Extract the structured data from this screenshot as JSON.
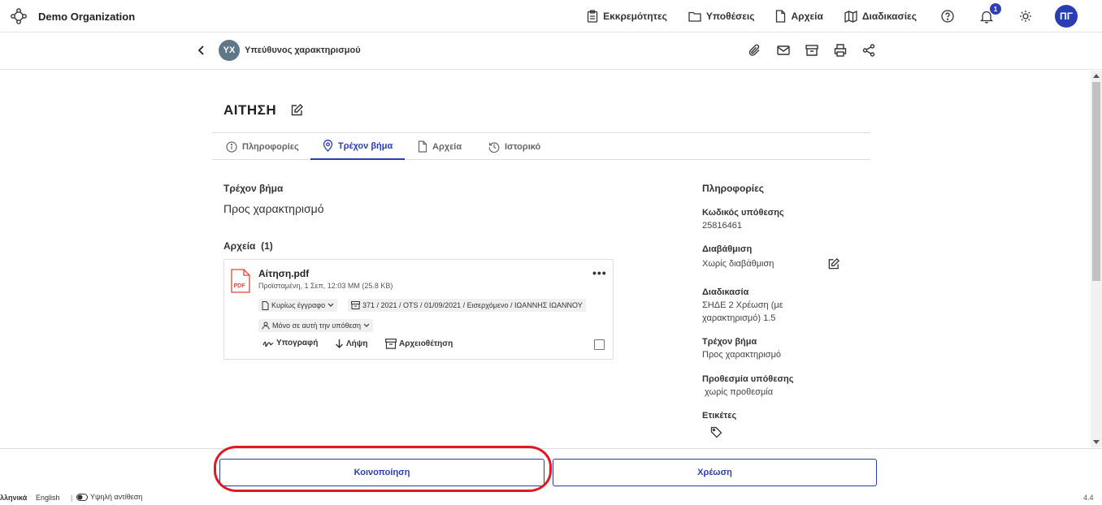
{
  "header": {
    "org_name": "Demo Organization",
    "nav": [
      {
        "label": "Εκκρεμότητες",
        "icon": "clipboard-icon"
      },
      {
        "label": "Υποθέσεις",
        "icon": "folder-icon"
      },
      {
        "label": "Αρχεία",
        "icon": "file-icon"
      },
      {
        "label": "Διαδικασίες",
        "icon": "map-icon"
      }
    ],
    "notification_count": "1",
    "user_initials": "ΠΓ"
  },
  "subheader": {
    "initials": "ΥΧ",
    "title": "Υπεύθυνος χαρακτηρισμού"
  },
  "case": {
    "title": "ΑΙΤΗΣΗ",
    "tabs": [
      {
        "label": "Πληροφορίες",
        "icon": "info-icon"
      },
      {
        "label": "Τρέχον βήμα",
        "icon": "location-pin-icon",
        "active": true
      },
      {
        "label": "Αρχεία",
        "icon": "file-icon"
      },
      {
        "label": "Ιστορικό",
        "icon": "history-icon"
      }
    ]
  },
  "current_step": {
    "label": "Τρέχον βήμα",
    "value": "Προς χαρακτηρισμό"
  },
  "files": {
    "header": "Αρχεία",
    "count": "(1)",
    "items": [
      {
        "name": "Αίτηση.pdf",
        "meta": "Προϊσταμένη, 1 Σεπ, 12:03 ΜΜ (25.8 KB)",
        "type_chip": "Κυρίως έγγραφο",
        "protocol_chip": "371 / 2021 / OTS / 01/09/2021 / Εισερχόμενο / ΙΩΑΝΝΗΣ ΙΩΑΝΝΟΥ",
        "scope_chip": "Μόνο σε αυτή την υπόθεση",
        "actions": [
          "Υπογραφή",
          "Λήψη",
          "Αρχειοθέτηση"
        ]
      }
    ]
  },
  "info_panel": {
    "title": "Πληροφορίες",
    "fields": [
      {
        "label": "Κωδικός υπόθεσης",
        "value": "25816461"
      },
      {
        "label": "Διαβάθμιση",
        "value": "Χωρίς διαβάθμιση"
      },
      {
        "label": "Διαδικασία",
        "value": "ΣΗΔΕ 2 Χρέωση (με χαρακτηρισμό) 1.5"
      },
      {
        "label": "Τρέχον βήμα",
        "value": "Προς χαρακτηρισμό"
      },
      {
        "label": "Προθεσμία υπόθεσης",
        "value": " χωρίς προθεσμία"
      },
      {
        "label": "Ετικέτες",
        "value": ""
      }
    ]
  },
  "footer_actions": {
    "share_label": "Κοινοποίηση",
    "assign_label": "Χρέωση"
  },
  "bottom_bar": {
    "lang_greek": "Ελληνικά",
    "lang_english": "English",
    "separator": "|",
    "high_contrast": "Υψηλή αντίθεση",
    "version": "4.4"
  },
  "colors": {
    "accent": "#2b3db3",
    "highlight": "#e01a22",
    "pdf": "#e0463a"
  }
}
